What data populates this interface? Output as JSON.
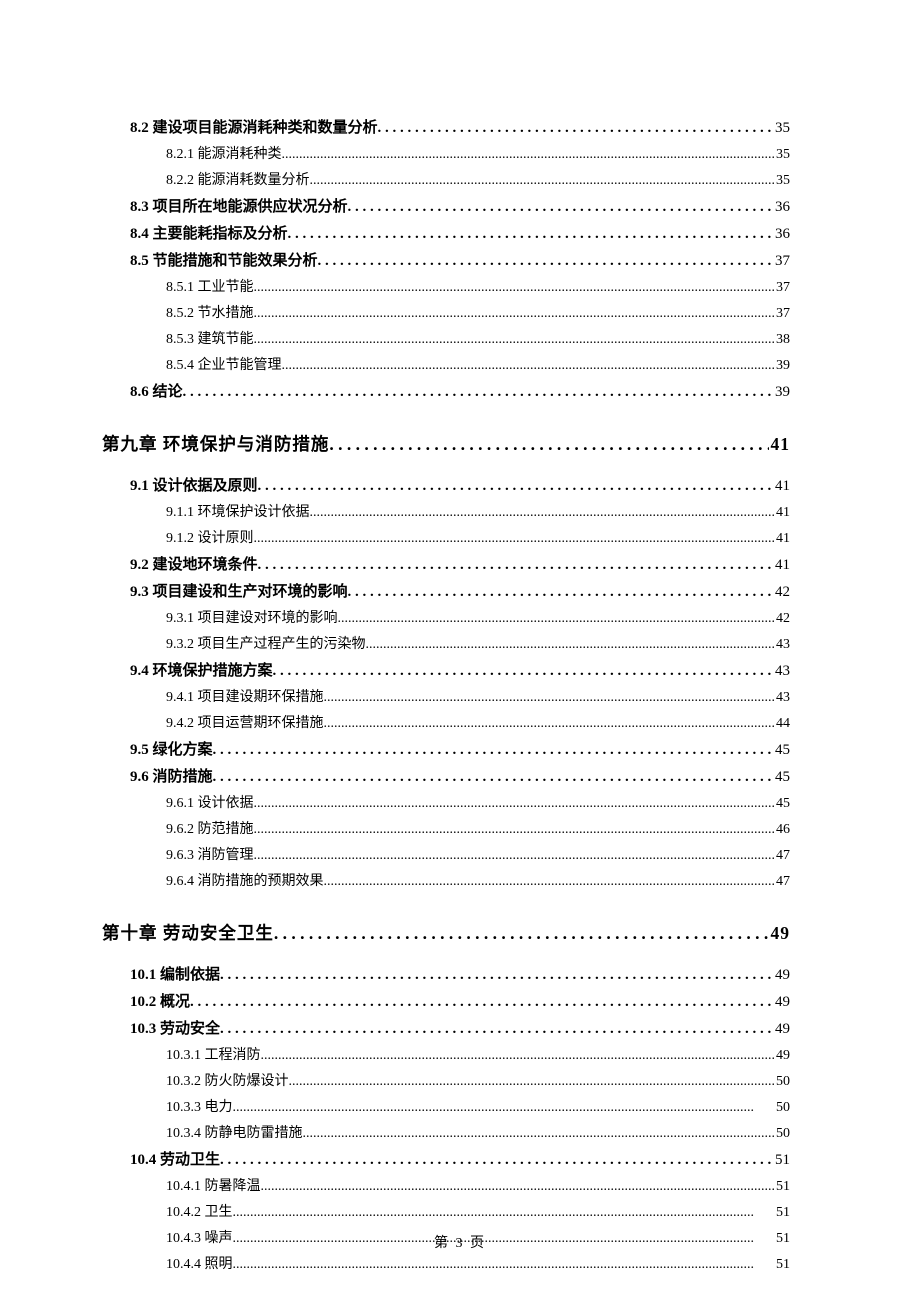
{
  "footer": "第 3 页",
  "toc": [
    {
      "level": 2,
      "label": "8.2 建设项目能源消耗种类和数量分析",
      "page": "35"
    },
    {
      "level": 3,
      "label": "8.2.1 能源消耗种类",
      "page": "35"
    },
    {
      "level": 3,
      "label": "8.2.2 能源消耗数量分析",
      "page": "35"
    },
    {
      "level": 2,
      "label": "8.3 项目所在地能源供应状况分析",
      "page": "36"
    },
    {
      "level": 2,
      "label": "8.4 主要能耗指标及分析",
      "page": "36"
    },
    {
      "level": 2,
      "label": "8.5 节能措施和节能效果分析",
      "page": "37"
    },
    {
      "level": 3,
      "label": "8.5.1 工业节能",
      "page": "37"
    },
    {
      "level": 3,
      "label": "8.5.2 节水措施",
      "page": "37"
    },
    {
      "level": 3,
      "label": "8.5.3 建筑节能",
      "page": "38"
    },
    {
      "level": 3,
      "label": "8.5.4 企业节能管理",
      "page": "39"
    },
    {
      "level": 2,
      "label": "8.6 结论",
      "page": "39"
    },
    {
      "level": 1,
      "label": "第九章 环境保护与消防措施",
      "page": "41"
    },
    {
      "level": 2,
      "label": "9.1 设计依据及原则",
      "page": "41"
    },
    {
      "level": 3,
      "label": "9.1.1 环境保护设计依据",
      "page": "41"
    },
    {
      "level": 3,
      "label": "9.1.2 设计原则",
      "page": "41"
    },
    {
      "level": 2,
      "label": "9.2 建设地环境条件",
      "page": "41"
    },
    {
      "level": 2,
      "label": "9.3  项目建设和生产对环境的影响",
      "page": "42"
    },
    {
      "level": 3,
      "label": "9.3.1  项目建设对环境的影响",
      "page": "42"
    },
    {
      "level": 3,
      "label": "9.3.2  项目生产过程产生的污染物",
      "page": "43"
    },
    {
      "level": 2,
      "label": "9.4  环境保护措施方案",
      "page": "43"
    },
    {
      "level": 3,
      "label": "9.4.1  项目建设期环保措施",
      "page": "43"
    },
    {
      "level": 3,
      "label": "9.4.2  项目运营期环保措施",
      "page": "44"
    },
    {
      "level": 2,
      "label": "9.5 绿化方案",
      "page": "45"
    },
    {
      "level": 2,
      "label": "9.6 消防措施",
      "page": "45"
    },
    {
      "level": 3,
      "label": "9.6.1 设计依据",
      "page": "45"
    },
    {
      "level": 3,
      "label": "9.6.2 防范措施",
      "page": "46"
    },
    {
      "level": 3,
      "label": "9.6.3 消防管理",
      "page": "47"
    },
    {
      "level": 3,
      "label": "9.6.4 消防措施的预期效果",
      "page": "47"
    },
    {
      "level": 1,
      "label": "第十章 劳动安全卫生",
      "page": "49"
    },
    {
      "level": 2,
      "label": "10.1  编制依据",
      "page": "49"
    },
    {
      "level": 2,
      "label": "10.2 概况",
      "page": "49"
    },
    {
      "level": 2,
      "label": "10.3  劳动安全",
      "page": "49"
    },
    {
      "level": 3,
      "label": "10.3.1 工程消防",
      "page": "49"
    },
    {
      "level": 3,
      "label": "10.3.2 防火防爆设计",
      "page": "50"
    },
    {
      "level": 3,
      "label": "10.3.3 电力",
      "page": "50"
    },
    {
      "level": 3,
      "label": "10.3.4 防静电防雷措施",
      "page": "50"
    },
    {
      "level": 2,
      "label": "10.4 劳动卫生",
      "page": "51"
    },
    {
      "level": 3,
      "label": "10.4.1 防暑降温",
      "page": "51"
    },
    {
      "level": 3,
      "label": "10.4.2 卫生",
      "page": "51"
    },
    {
      "level": 3,
      "label": "10.4.3 噪声",
      "page": "51"
    },
    {
      "level": 3,
      "label": "10.4.4 照明",
      "page": "51"
    }
  ]
}
